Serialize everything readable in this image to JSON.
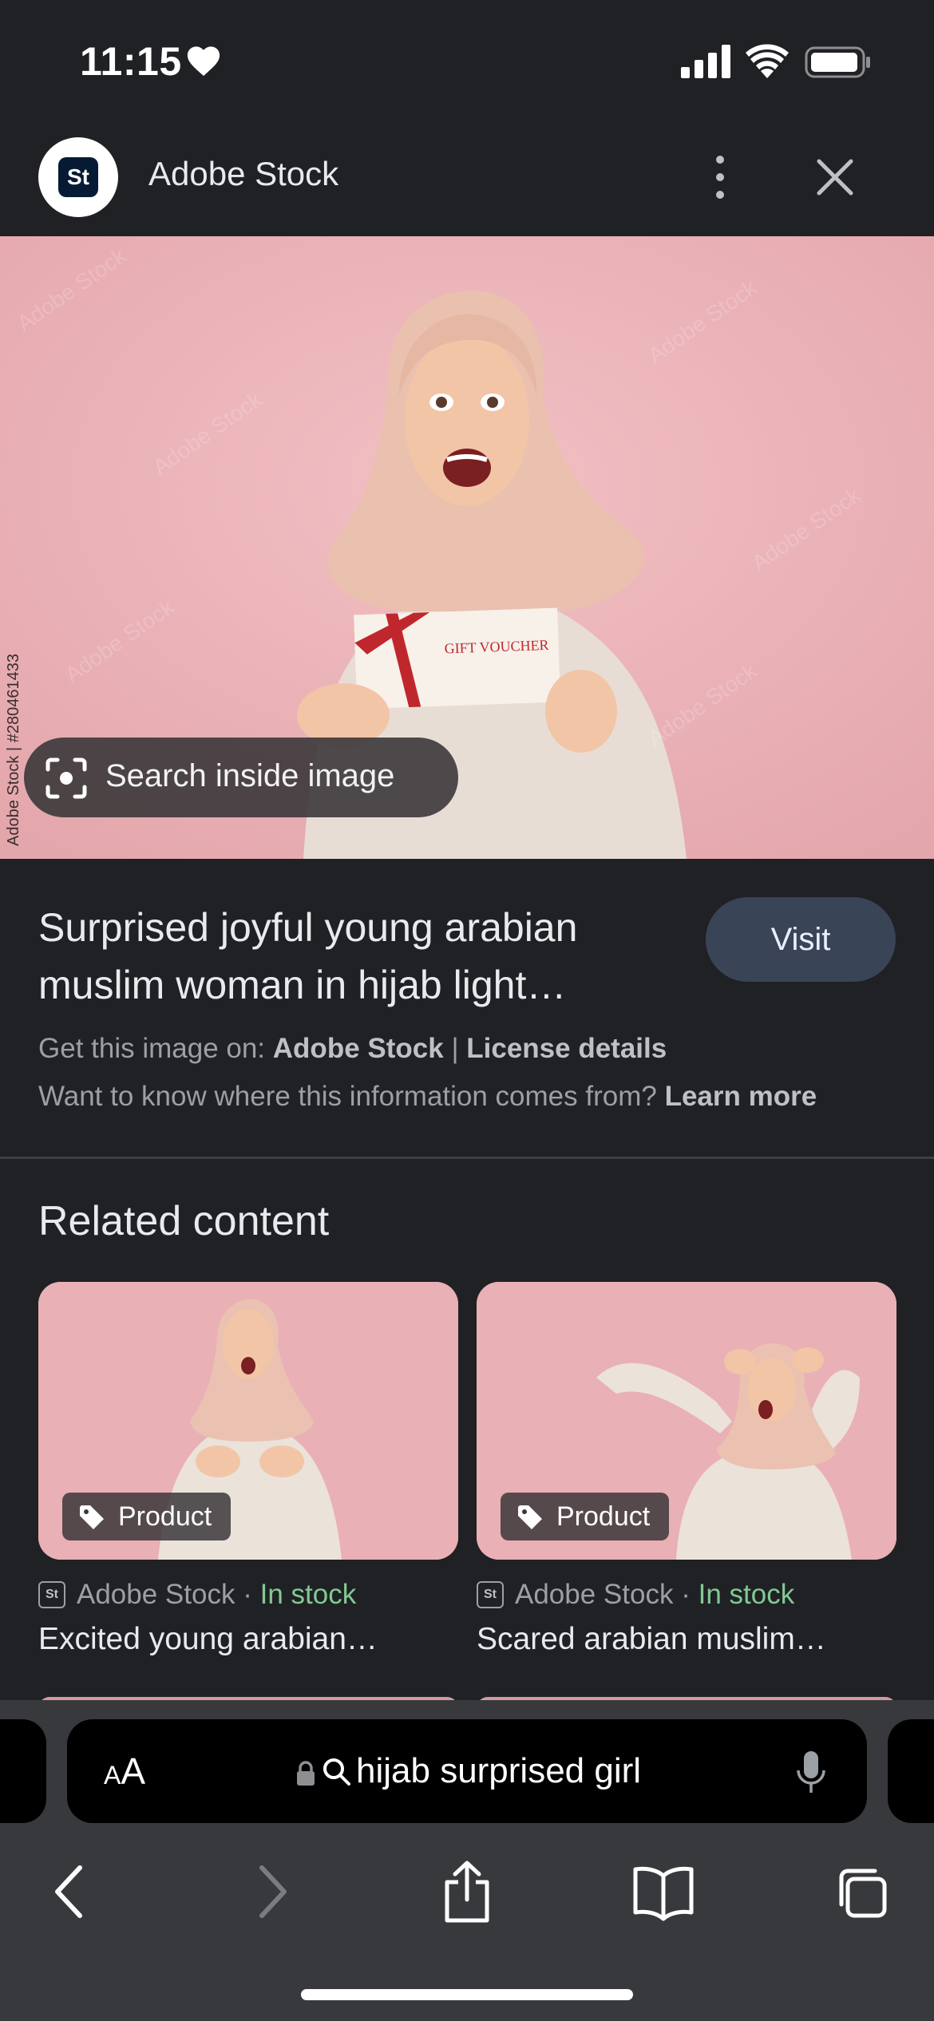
{
  "status_bar": {
    "time": "11:15"
  },
  "header": {
    "logo_text": "St",
    "site_name": "Adobe Stock"
  },
  "hero": {
    "voucher_text": "GIFT VOUCHER",
    "side_watermark": "Adobe Stock | #280461433",
    "search_inside_label": "Search inside image"
  },
  "info": {
    "title_line1": "Surprised joyful young arabian",
    "title_line2": "muslim woman in hijab light…",
    "visit_label": "Visit",
    "get_image_prefix": "Get this image on:",
    "get_image_source": "Adobe Stock",
    "separator": "|",
    "license_label": "License details",
    "where_info": "Want to know where this information comes from?",
    "learn_more": "Learn more"
  },
  "related": {
    "heading": "Related content",
    "cards": [
      {
        "badge": "Product",
        "source": "Adobe Stock",
        "dot": "·",
        "stock": "In stock",
        "title": "Excited young arabian…"
      },
      {
        "badge": "Product",
        "source": "Adobe Stock",
        "dot": "·",
        "stock": "In stock",
        "title": "Scared arabian muslim…"
      }
    ]
  },
  "safari": {
    "text_size_label_small": "A",
    "text_size_label_large": "A",
    "url_text": "hijab surprised girl"
  },
  "colors": {
    "background": "#202124",
    "visit_button": "#394457",
    "in_stock": "#81c995",
    "hero_pink": "#eab3b7"
  }
}
